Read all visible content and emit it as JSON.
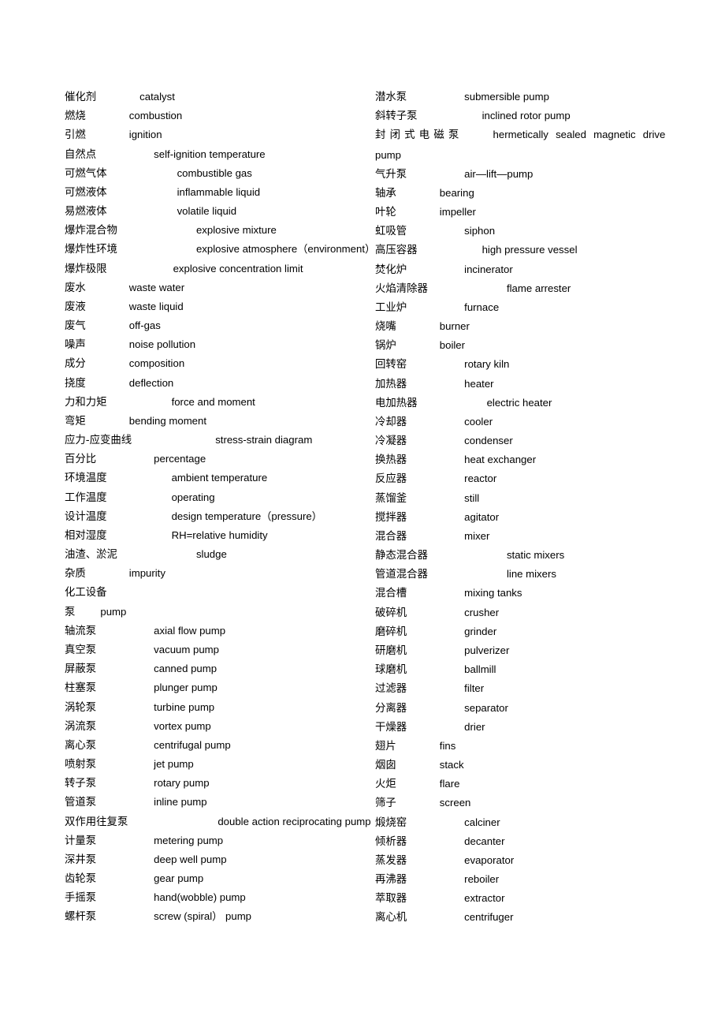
{
  "document": {
    "type": "bilingual-glossary",
    "language_pair": "Chinese-English",
    "columns": 2
  },
  "left_column": [
    {
      "cn": "催化剂",
      "en": "catalyst",
      "tab": 55
    },
    {
      "cn": "燃烧",
      "en": "combustion",
      "tab": 55
    },
    {
      "cn": "引燃",
      "en": "ignition",
      "tab": 55
    },
    {
      "cn": "自然点",
      "en": "self-ignition temperature",
      "tab": 73
    },
    {
      "cn": "可燃气体",
      "en": "combustible gas",
      "tab": 89
    },
    {
      "cn": "可燃液体",
      "en": "inflammable liquid",
      "tab": 89
    },
    {
      "cn": "易燃液体",
      "en": "volatile liquid",
      "tab": 89
    },
    {
      "cn": "爆炸混合物",
      "en": "explosive mixture",
      "tab": 100
    },
    {
      "cn": "爆炸性环境",
      "en": "explosive atmosphere（environment）",
      "tab": 100
    },
    {
      "cn": "爆炸极限",
      "en": "explosive concentration limit",
      "tab": 84
    },
    {
      "cn": "废水",
      "en": "waste water",
      "tab": 55
    },
    {
      "cn": "废液",
      "en": "waste liquid",
      "tab": 55
    },
    {
      "cn": "废气",
      "en": "off-gas",
      "tab": 55
    },
    {
      "cn": "噪声",
      "en": "noise pollution",
      "tab": 55
    },
    {
      "cn": "成分",
      "en": "composition",
      "tab": 55
    },
    {
      "cn": "挠度",
      "en": "deflection",
      "tab": 55
    },
    {
      "cn": "力和力矩",
      "en": "force and moment",
      "tab": 82
    },
    {
      "cn": "弯矩",
      "en": "bending moment",
      "tab": 55
    },
    {
      "cn": "应力-应变曲线",
      "en": "stress-strain diagram",
      "tab": 106
    },
    {
      "cn": "百分比",
      "en": "percentage",
      "tab": 73
    },
    {
      "cn": "环境温度",
      "en": "ambient temperature",
      "tab": 82
    },
    {
      "cn": "工作温度",
      "en": "operating",
      "tab": 82
    },
    {
      "cn": "设计温度",
      "en": "design temperature（pressure）",
      "tab": 82
    },
    {
      "cn": "相对湿度",
      "en": "RH=relative humidity",
      "tab": 82
    },
    {
      "cn": "油渣、淤泥",
      "en": "sludge",
      "tab": 100
    },
    {
      "cn": "杂质",
      "en": "impurity",
      "tab": 55
    },
    {
      "cn": "化工设备",
      "en": "",
      "tab": 82
    },
    {
      "cn": "泵",
      "en": "pump",
      "tab": 32
    },
    {
      "cn": "轴流泵",
      "en": "axial flow pump",
      "tab": 73
    },
    {
      "cn": "真空泵",
      "en": "vacuum pump",
      "tab": 73
    },
    {
      "cn": "屏蔽泵",
      "en": "canned pump",
      "tab": 73
    },
    {
      "cn": "柱塞泵",
      "en": "plunger pump",
      "tab": 73
    },
    {
      "cn": "涡轮泵",
      "en": "turbine pump",
      "tab": 73
    },
    {
      "cn": "涡流泵",
      "en": "vortex pump",
      "tab": 73
    },
    {
      "cn": "离心泵",
      "en": "centrifugal pump",
      "tab": 73
    },
    {
      "cn": "喷射泵",
      "en": "jet pump",
      "tab": 73
    },
    {
      "cn": "转子泵",
      "en": "rotary pump",
      "tab": 73
    },
    {
      "cn": "管道泵",
      "en": "inline pump",
      "tab": 73
    },
    {
      "cn": "双作用往复泵",
      "en": "double action reciprocating pump",
      "tab": 114
    },
    {
      "cn": "计量泵",
      "en": "metering pump",
      "tab": 73
    },
    {
      "cn": "深井泵",
      "en": "deep well pump",
      "tab": 73
    },
    {
      "cn": "齿轮泵",
      "en": "gear pump",
      "tab": 73
    },
    {
      "cn": "手摇泵",
      "en": "hand(wobble) pump",
      "tab": 73
    },
    {
      "cn": "螺杆泵",
      "en": "screw (spiral）  pump",
      "tab": 73
    }
  ],
  "right_column": [
    {
      "cn": "潜水泵",
      "en": "submersible pump",
      "tab": 73
    },
    {
      "cn": "斜转子泵",
      "en": "inclined rotor pump",
      "tab": 82
    },
    {
      "cn": "封闭式电磁泵",
      "en": "hermetically sealed magnetic drive pump",
      "tab": 0,
      "justified": true,
      "wrap_tail": "pump"
    },
    {
      "cn": "气升泵",
      "en": "air—lift—pump",
      "tab": 73
    },
    {
      "cn": "轴承",
      "en": "bearing",
      "tab": 55
    },
    {
      "cn": "叶轮",
      "en": "impeller",
      "tab": 55
    },
    {
      "cn": "虹吸管",
      "en": "siphon",
      "tab": 73
    },
    {
      "cn": "高压容器",
      "en": "high pressure vessel",
      "tab": 82
    },
    {
      "cn": "焚化炉",
      "en": "incinerator",
      "tab": 73
    },
    {
      "cn": "火焰清除器",
      "en": "flame arrester",
      "tab": 100
    },
    {
      "cn": "工业炉",
      "en": "furnace",
      "tab": 73
    },
    {
      "cn": "烧嘴",
      "en": "burner",
      "tab": 55
    },
    {
      "cn": "锅炉",
      "en": "boiler",
      "tab": 55
    },
    {
      "cn": "回转窑",
      "en": "rotary kiln",
      "tab": 73
    },
    {
      "cn": "加热器",
      "en": "heater",
      "tab": 73
    },
    {
      "cn": "电加热器",
      "en": "electric heater",
      "tab": 88
    },
    {
      "cn": "冷却器",
      "en": "cooler",
      "tab": 73
    },
    {
      "cn": "冷凝器",
      "en": "condenser",
      "tab": 73
    },
    {
      "cn": "换热器",
      "en": "heat exchanger",
      "tab": 73
    },
    {
      "cn": "反应器",
      "en": "reactor",
      "tab": 73
    },
    {
      "cn": "蒸馏釜",
      "en": "still",
      "tab": 73
    },
    {
      "cn": "搅拌器",
      "en": "agitator",
      "tab": 73
    },
    {
      "cn": "混合器",
      "en": "mixer",
      "tab": 73
    },
    {
      "cn": "静态混合器",
      "en": "static mixers",
      "tab": 100
    },
    {
      "cn": "管道混合器",
      "en": "line mixers",
      "tab": 100
    },
    {
      "cn": "混合槽",
      "en": "mixing tanks",
      "tab": 73
    },
    {
      "cn": "破碎机",
      "en": "crusher",
      "tab": 73
    },
    {
      "cn": "磨碎机",
      "en": "grinder",
      "tab": 73
    },
    {
      "cn": "研磨机",
      "en": "pulverizer",
      "tab": 73
    },
    {
      "cn": "球磨机",
      "en": "ballmill",
      "tab": 73
    },
    {
      "cn": "过滤器",
      "en": "filter",
      "tab": 73
    },
    {
      "cn": "分离器",
      "en": "separator",
      "tab": 73
    },
    {
      "cn": "干燥器",
      "en": "drier",
      "tab": 73
    },
    {
      "cn": "翅片",
      "en": "fins",
      "tab": 55
    },
    {
      "cn": "烟囱",
      "en": "stack",
      "tab": 55
    },
    {
      "cn": "火炬",
      "en": "flare",
      "tab": 55
    },
    {
      "cn": "筛子",
      "en": "screen",
      "tab": 55
    },
    {
      "cn": "煅烧窑",
      "en": "calciner",
      "tab": 73
    },
    {
      "cn": "倾析器",
      "en": "decanter",
      "tab": 73
    },
    {
      "cn": "蒸发器",
      "en": "evaporator",
      "tab": 73
    },
    {
      "cn": "再沸器",
      "en": "reboiler",
      "tab": 73
    },
    {
      "cn": "萃取器",
      "en": "extractor",
      "tab": 73
    },
    {
      "cn": "离心机",
      "en": "centrifuger",
      "tab": 73
    }
  ]
}
